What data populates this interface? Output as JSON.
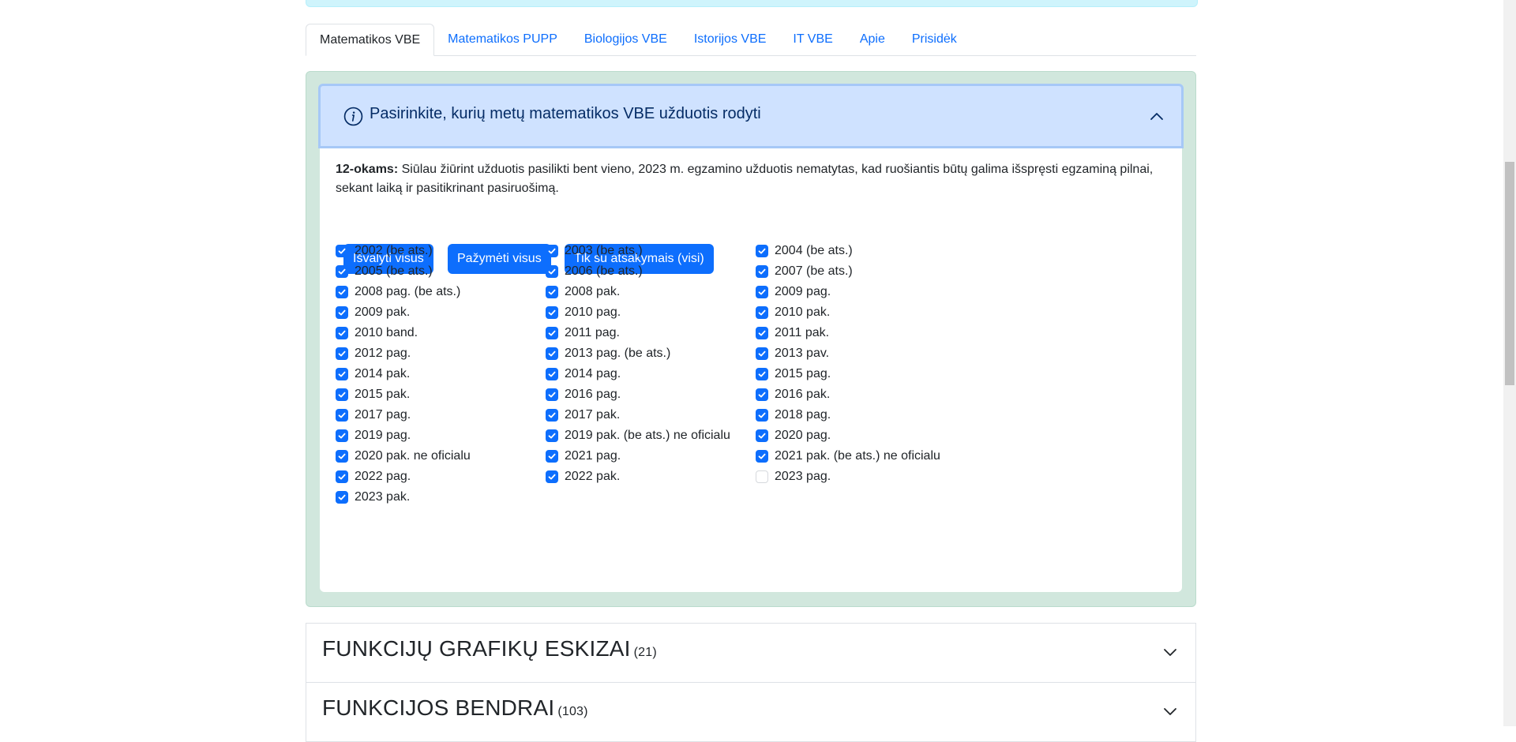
{
  "tabs": [
    {
      "label": "Matematikos VBE",
      "active": true
    },
    {
      "label": "Matematikos PUPP",
      "active": false
    },
    {
      "label": "Biologijos VBE",
      "active": false
    },
    {
      "label": "Istorijos VBE",
      "active": false
    },
    {
      "label": "IT VBE",
      "active": false
    },
    {
      "label": "Apie",
      "active": false
    },
    {
      "label": "Prisidėk",
      "active": false
    }
  ],
  "accordion": {
    "title": "Pasirinkite, kurių metų matematikos VBE užduotis rodyti",
    "icon": "info-icon",
    "expanded": true
  },
  "note": {
    "bold": "12-okams:",
    "text": " Siūlau žiūrint užduotis pasilikti bent vieno, 2023 m. egzamino užduotis nematytas, kad ruošiantis būtų galima išspręsti egzaminą pilnai, sekant laiką ir pasitikrinant pasiruošimą."
  },
  "buttons": {
    "clear_all": "Išvalyti visus",
    "select_all": "Pažymėti visus",
    "only_with_answers": "Tik su atsakymais (visi)"
  },
  "colors": {
    "primary": "#0d6efd",
    "panel_bg": "#d1e7dd",
    "header_bg": "#cfe2ff"
  },
  "checkboxes": [
    {
      "label": "2002 (be ats.)",
      "checked": true
    },
    {
      "label": "2003 (be ats.)",
      "checked": true
    },
    {
      "label": "2004 (be ats.)",
      "checked": true
    },
    {
      "label": "2005 (be ats.)",
      "checked": true
    },
    {
      "label": "2006 (be ats.)",
      "checked": true
    },
    {
      "label": "2007 (be ats.)",
      "checked": true
    },
    {
      "label": "2008 pag. (be ats.)",
      "checked": true
    },
    {
      "label": "2008 pak.",
      "checked": true
    },
    {
      "label": "2009 pag.",
      "checked": true
    },
    {
      "label": "2009 pak.",
      "checked": true
    },
    {
      "label": "2010 pag.",
      "checked": true
    },
    {
      "label": "2010 pak.",
      "checked": true
    },
    {
      "label": "2010 band.",
      "checked": true
    },
    {
      "label": "2011 pag.",
      "checked": true
    },
    {
      "label": "2011 pak.",
      "checked": true
    },
    {
      "label": "2012 pag.",
      "checked": true
    },
    {
      "label": "2013 pag. (be ats.)",
      "checked": true
    },
    {
      "label": "2013 pav.",
      "checked": true
    },
    {
      "label": "2014 pak.",
      "checked": true
    },
    {
      "label": "2014 pag.",
      "checked": true
    },
    {
      "label": "2015 pag.",
      "checked": true
    },
    {
      "label": "2015 pak.",
      "checked": true
    },
    {
      "label": "2016 pag.",
      "checked": true
    },
    {
      "label": "2016 pak.",
      "checked": true
    },
    {
      "label": "2017 pag.",
      "checked": true
    },
    {
      "label": "2017 pak.",
      "checked": true
    },
    {
      "label": "2018 pag.",
      "checked": true
    },
    {
      "label": "2019 pag.",
      "checked": true
    },
    {
      "label": "2019 pak. (be ats.) ne oficialu",
      "checked": true
    },
    {
      "label": "2020 pag.",
      "checked": true
    },
    {
      "label": "2020 pak. ne oficialu",
      "checked": true
    },
    {
      "label": "2021 pag.",
      "checked": true
    },
    {
      "label": "2021 pak. (be ats.) ne oficialu",
      "checked": true
    },
    {
      "label": "2022 pag.",
      "checked": true
    },
    {
      "label": "2022 pak.",
      "checked": true
    },
    {
      "label": "2023 pag.",
      "checked": false
    },
    {
      "label": "2023 pak.",
      "checked": true
    }
  ],
  "sections": [
    {
      "title": "FUNKCIJŲ GRAFIKŲ ESKIZAI",
      "count": "(21)"
    },
    {
      "title": "FUNKCIJOS BENDRAI",
      "count": "(103)"
    }
  ]
}
